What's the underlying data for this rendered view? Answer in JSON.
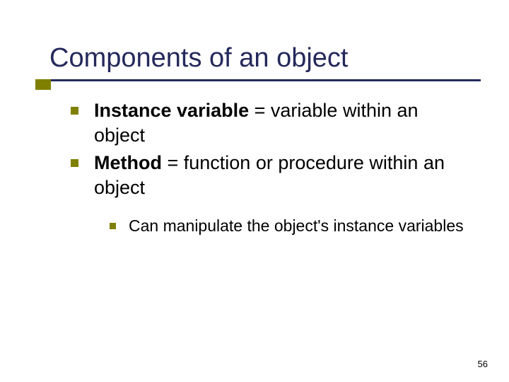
{
  "title": "Components of an object",
  "bullets": [
    {
      "bold": "Instance variable",
      "rest": " = variable within an object"
    },
    {
      "bold": "Method",
      "rest": " = function or procedure within an object"
    }
  ],
  "subBullets": [
    {
      "text": "Can manipulate the object's instance variables"
    }
  ],
  "pageNumber": "56"
}
